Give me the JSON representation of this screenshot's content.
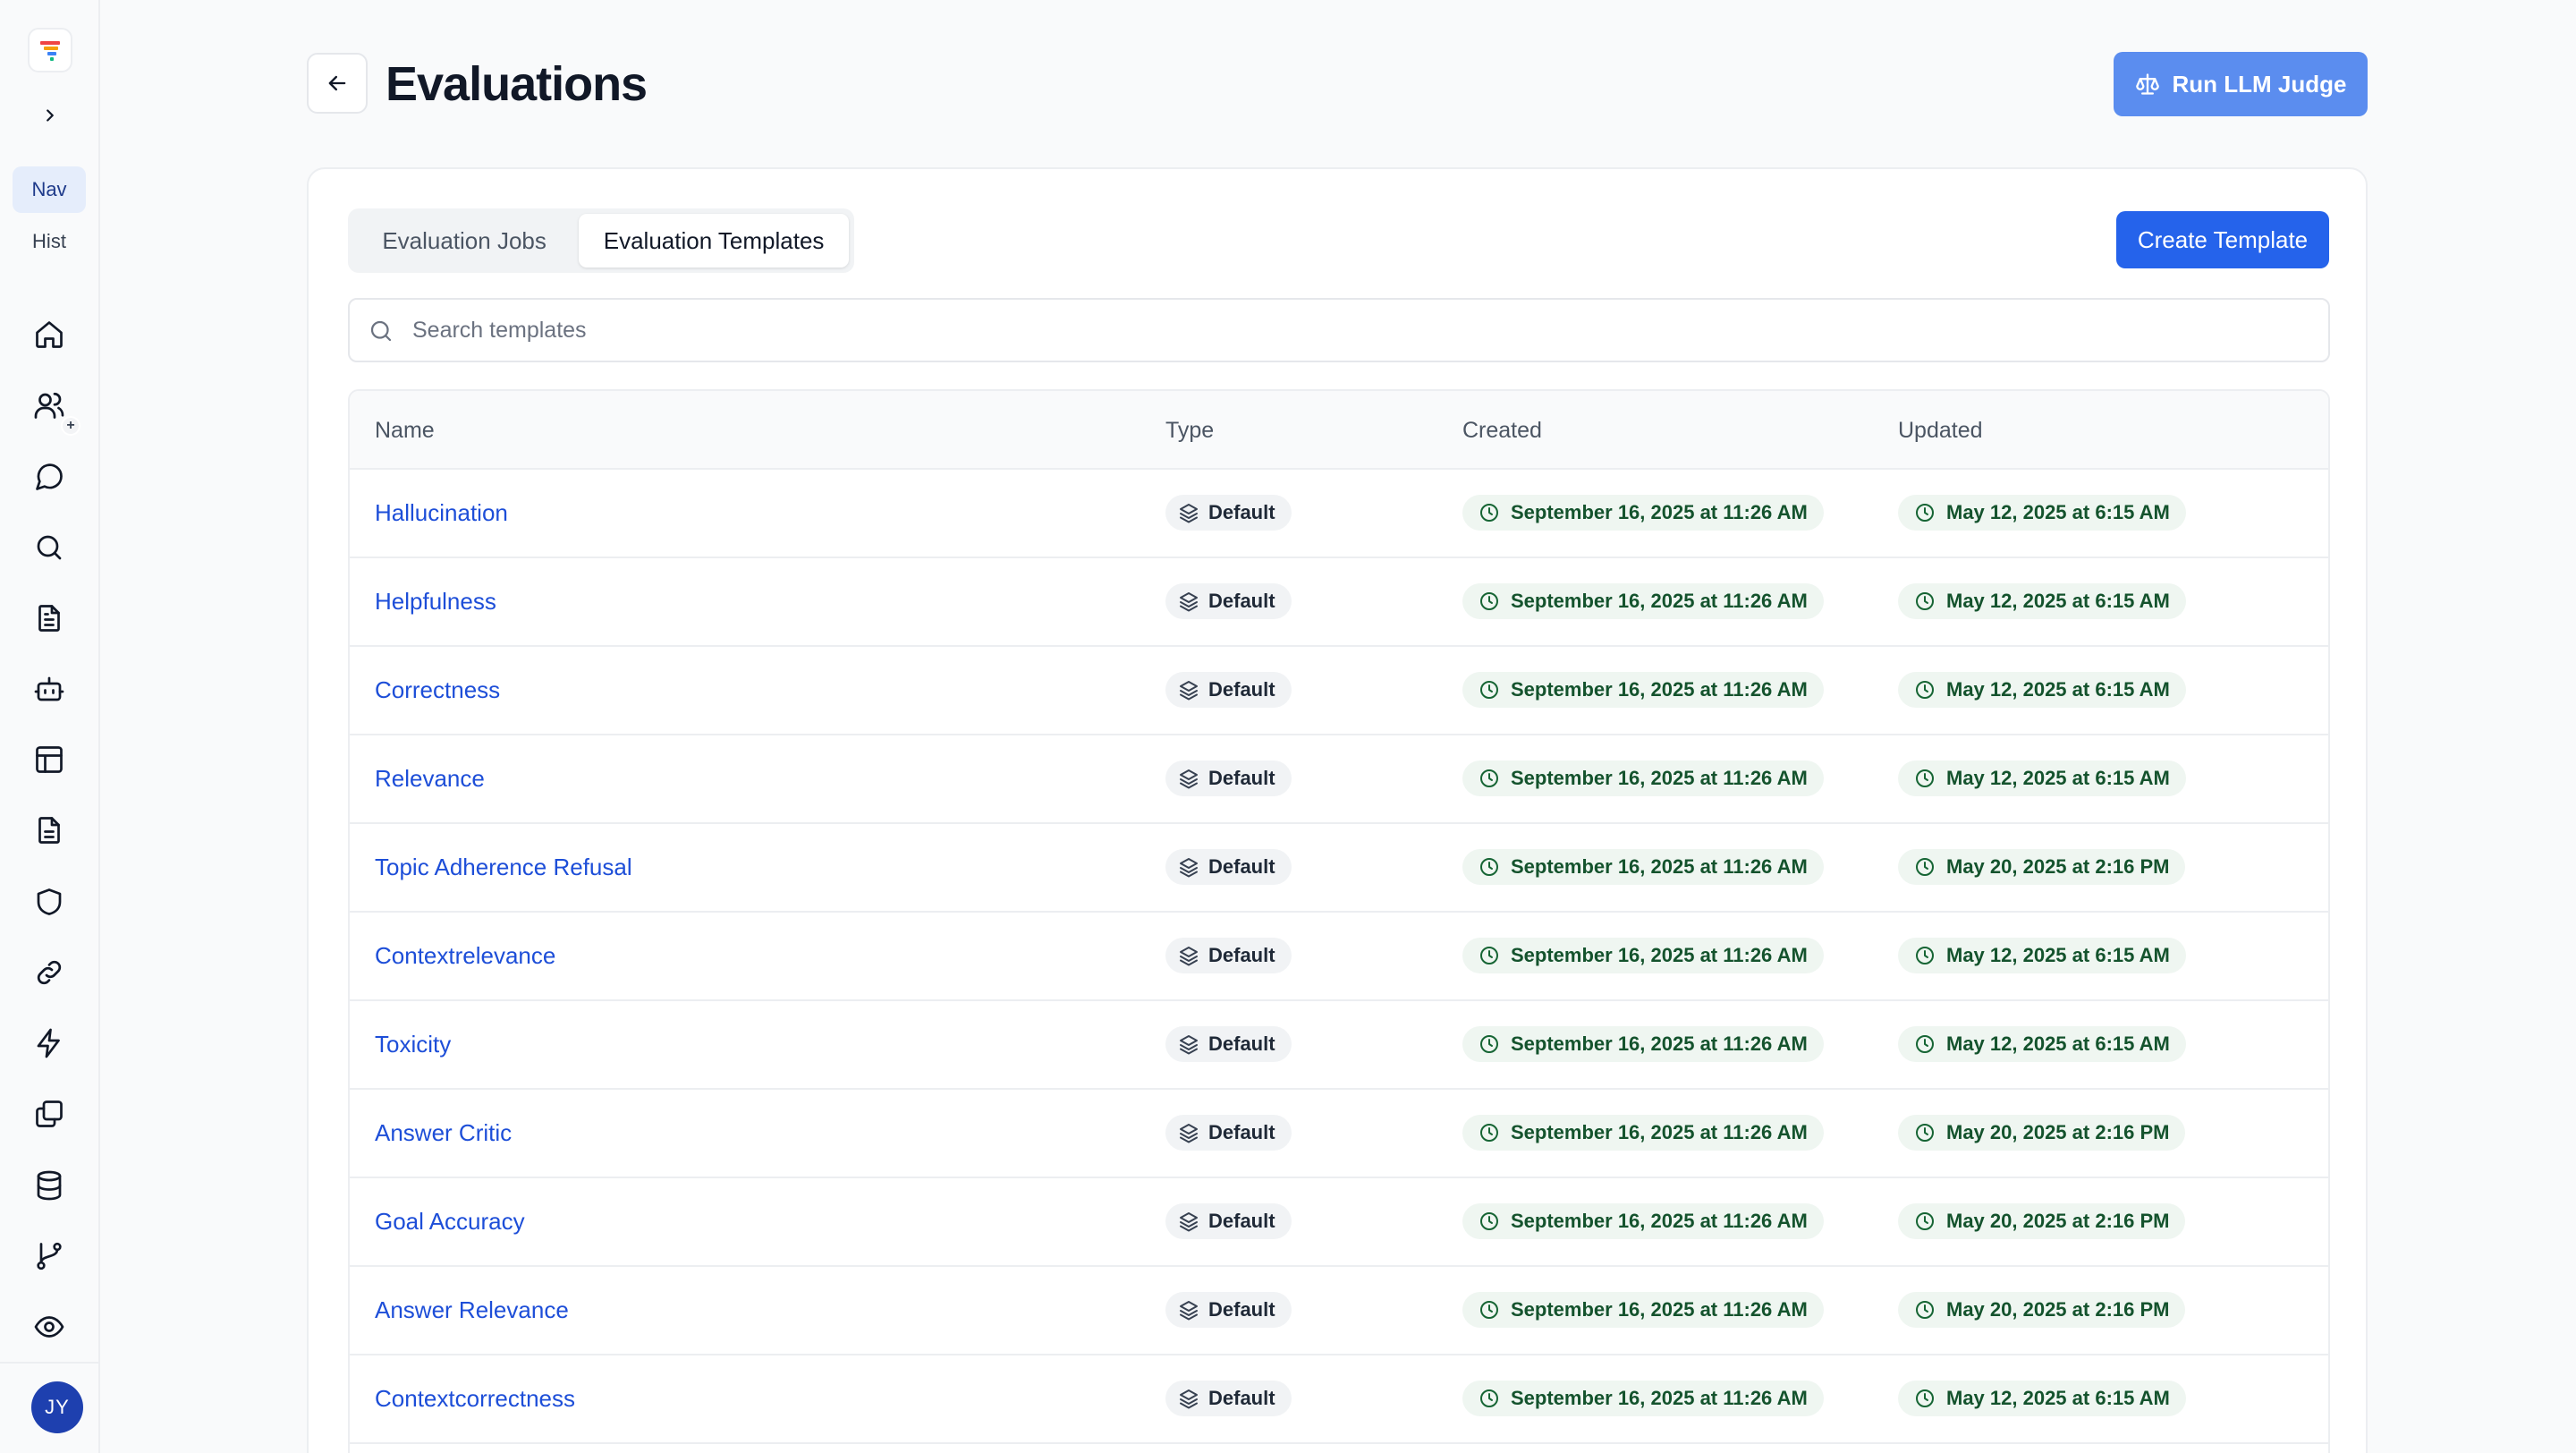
{
  "sidebar": {
    "nav_label": "Nav",
    "hist_label": "Hist",
    "icons": [
      "home-icon",
      "users-icon",
      "chat-icon",
      "search-icon",
      "document-icon",
      "bot-icon",
      "layout-icon",
      "file-text-icon",
      "shield-icon",
      "link-icon",
      "zap-icon",
      "copy-icon",
      "database-icon",
      "git-branch-icon",
      "eye-icon"
    ],
    "badge": "+",
    "avatar_initials": "JY"
  },
  "header": {
    "title": "Evaluations",
    "run_button": "Run LLM Judge"
  },
  "tabs": {
    "jobs": "Evaluation Jobs",
    "templates": "Evaluation Templates",
    "active": "Evaluation Templates"
  },
  "create_button": "Create Template",
  "search": {
    "placeholder": "Search templates",
    "value": ""
  },
  "table": {
    "columns": {
      "name": "Name",
      "type": "Type",
      "created": "Created",
      "updated": "Updated"
    },
    "rows": [
      {
        "name": "Hallucination",
        "type": "Default",
        "created": "September 16, 2025 at 11:26 AM",
        "updated": "May 12, 2025 at 6:15 AM"
      },
      {
        "name": "Helpfulness",
        "type": "Default",
        "created": "September 16, 2025 at 11:26 AM",
        "updated": "May 12, 2025 at 6:15 AM"
      },
      {
        "name": "Correctness",
        "type": "Default",
        "created": "September 16, 2025 at 11:26 AM",
        "updated": "May 12, 2025 at 6:15 AM"
      },
      {
        "name": "Relevance",
        "type": "Default",
        "created": "September 16, 2025 at 11:26 AM",
        "updated": "May 12, 2025 at 6:15 AM"
      },
      {
        "name": "Topic Adherence Refusal",
        "type": "Default",
        "created": "September 16, 2025 at 11:26 AM",
        "updated": "May 20, 2025 at 2:16 PM"
      },
      {
        "name": "Contextrelevance",
        "type": "Default",
        "created": "September 16, 2025 at 11:26 AM",
        "updated": "May 12, 2025 at 6:15 AM"
      },
      {
        "name": "Toxicity",
        "type": "Default",
        "created": "September 16, 2025 at 11:26 AM",
        "updated": "May 12, 2025 at 6:15 AM"
      },
      {
        "name": "Answer Critic",
        "type": "Default",
        "created": "September 16, 2025 at 11:26 AM",
        "updated": "May 20, 2025 at 2:16 PM"
      },
      {
        "name": "Goal Accuracy",
        "type": "Default",
        "created": "September 16, 2025 at 11:26 AM",
        "updated": "May 20, 2025 at 2:16 PM"
      },
      {
        "name": "Answer Relevance",
        "type": "Default",
        "created": "September 16, 2025 at 11:26 AM",
        "updated": "May 20, 2025 at 2:16 PM"
      },
      {
        "name": "Contextcorrectness",
        "type": "Default",
        "created": "September 16, 2025 at 11:26 AM",
        "updated": "May 12, 2025 at 6:15 AM"
      }
    ]
  },
  "colors": {
    "primary": "#2563eb",
    "run_button": "#5b8def",
    "link": "#1d4ed8",
    "date_badge_bg": "#eff6f1",
    "date_badge_text": "#14532d",
    "avatar": "#1e40af"
  }
}
